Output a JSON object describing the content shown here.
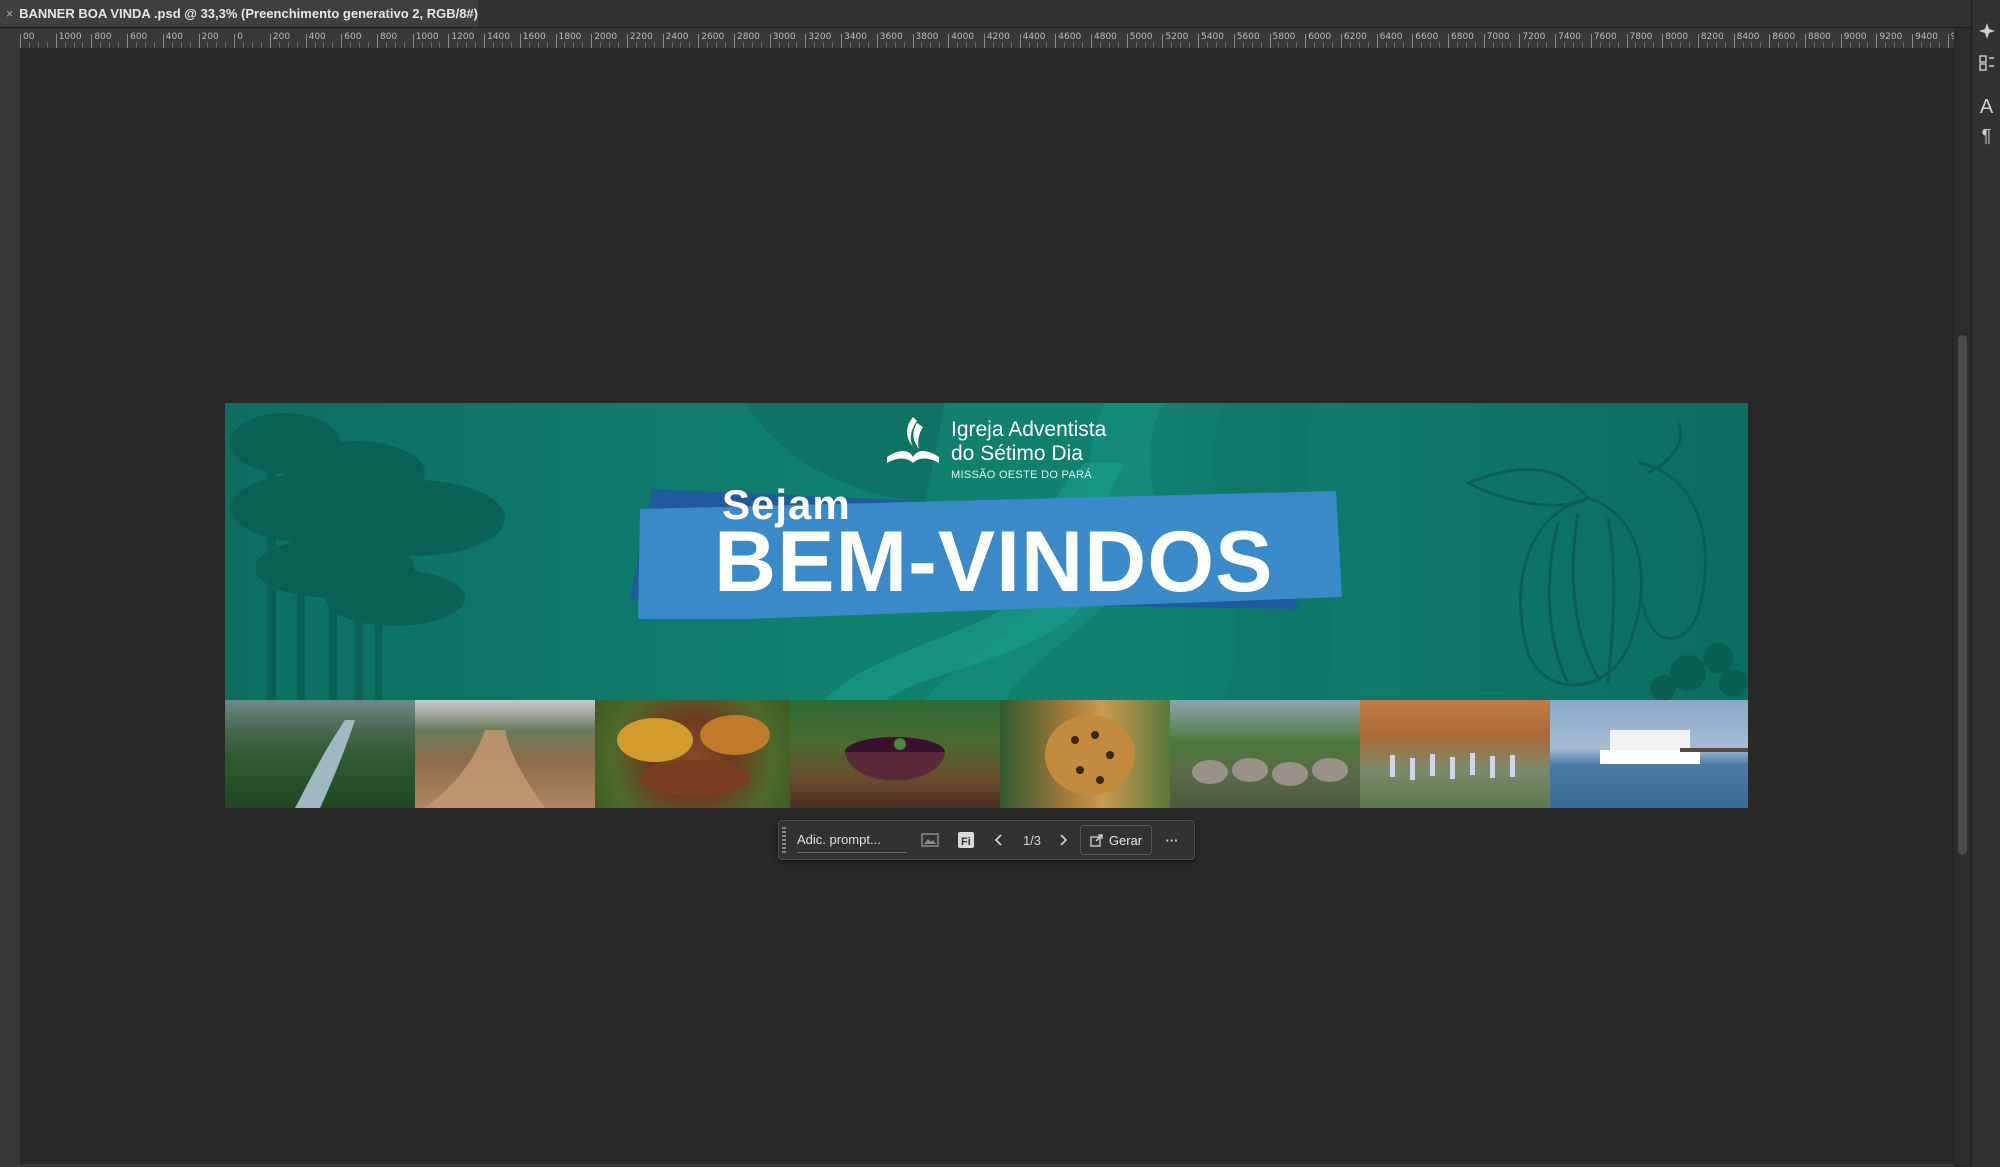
{
  "document_tab": {
    "title": "BANNER BOA VINDA .psd @ 33,3% (Preenchimento generativo 2, RGB/8#)",
    "close_glyph": "×"
  },
  "ruler_top_labels": [
    "00",
    "1000",
    "800",
    "600",
    "400",
    "200",
    "0",
    "200",
    "400",
    "600",
    "800",
    "1000",
    "1200",
    "1400",
    "1600",
    "1800",
    "2000",
    "2200",
    "2400",
    "2600",
    "2800",
    "3000",
    "3200",
    "3400",
    "3600",
    "3800",
    "4000",
    "4200",
    "4400",
    "4600",
    "4800",
    "5000",
    "5200",
    "5400",
    "5600",
    "5800",
    "6000",
    "6200",
    "6400",
    "6600",
    "6800",
    "7000",
    "7200",
    "7400",
    "7600",
    "7800",
    "8000",
    "8200",
    "8400",
    "8600",
    "8800",
    "9000",
    "9200",
    "9400",
    "9"
  ],
  "banner": {
    "logo_line1": "Igreja Adventista",
    "logo_line2": "do Sétimo Dia",
    "logo_line3": "MISSÃO OESTE DO PARÁ",
    "headline_small": "Sejam",
    "headline_large": "BEM-VINDOS",
    "photos": [
      "river-forest-photo",
      "dirt-road-photo",
      "cacao-beans-photo",
      "acai-bowl-photo",
      "jaguar-photo",
      "cattle-photo",
      "boats-on-beach-photo",
      "riverboat-photo"
    ],
    "colors": {
      "teal": "#0f7a6c",
      "blue": "#3a8ac9",
      "dark_blue": "#1f5a9c"
    }
  },
  "taskbar": {
    "prompt_placeholder": "Adic. prompt...",
    "page_indicator": "1/3",
    "generate_label": "Gerar",
    "more_glyph": "···"
  },
  "right_panel": {
    "text_tool_glyph": "A",
    "paragraph_glyph": "¶"
  }
}
